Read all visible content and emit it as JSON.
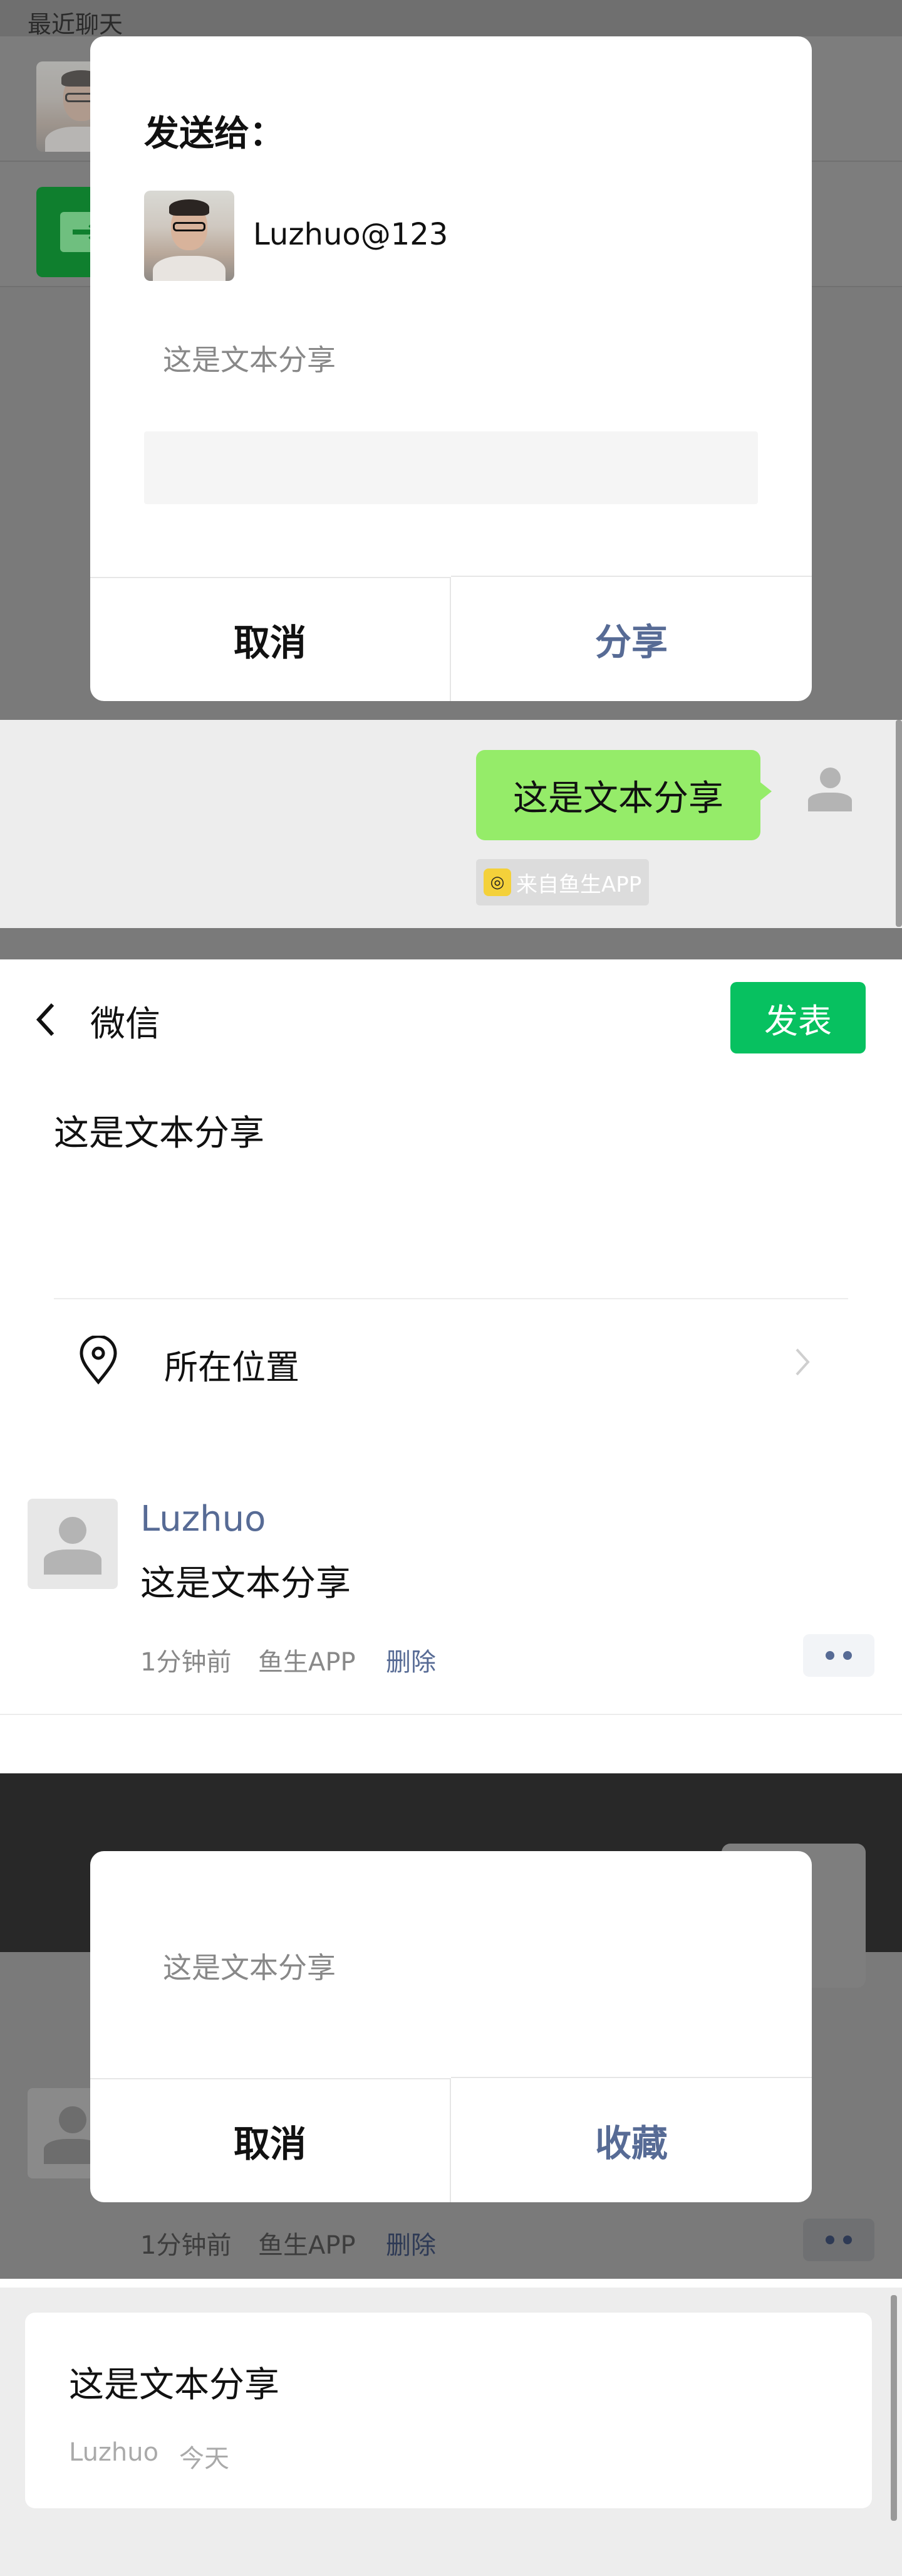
{
  "share_dialog": {
    "recent_header": "最近聊天",
    "title": "发送给：",
    "recipient_name": "Luzhuo@123",
    "preview_text": "这是文本分享",
    "message_placeholder": "",
    "cancel_label": "取消",
    "confirm_label": "分享"
  },
  "chat": {
    "bubble_text": "这是文本分享",
    "source_label": "来自鱼生APP"
  },
  "moments_compose": {
    "back_label": "微信",
    "publish_label": "发表",
    "content_text": "这是文本分享",
    "location_label": "所在位置"
  },
  "moment_post": {
    "author": "Luzhuo",
    "text": "这是文本分享",
    "time": "1分钟前",
    "source": "鱼生APP",
    "delete_label": "删除"
  },
  "favorite_dialog": {
    "preview_text": "这是文本分享",
    "cancel_label": "取消",
    "confirm_label": "收藏",
    "behind_time": "1分钟前",
    "behind_source": "鱼生APP",
    "behind_delete": "删除"
  },
  "favorite_card": {
    "text": "这是文本分享",
    "author": "Luzhuo",
    "date": "今天"
  },
  "colors": {
    "wechat_green": "#07c160",
    "bubble_green": "#95ec69",
    "link_blue": "#576b95"
  },
  "icons": [
    "back-chevron-icon",
    "location-pin-icon",
    "chevron-right-icon",
    "default-avatar-icon",
    "app-logo-icon",
    "file-transfer-icon"
  ]
}
